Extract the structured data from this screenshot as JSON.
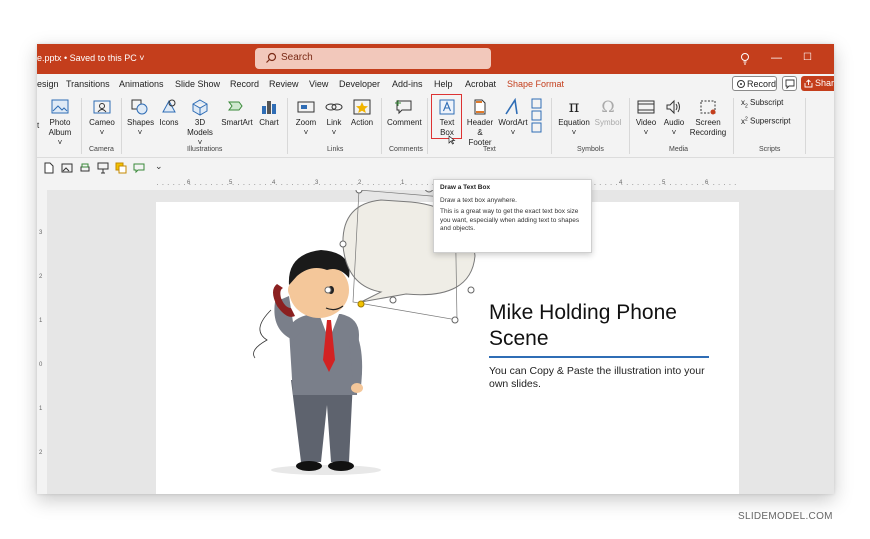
{
  "titlebar": {
    "filename": "e.pptx  •  Saved to this PC ˅",
    "search_placeholder": "Search",
    "help_icon": "lightbulb-icon",
    "minimize_glyph": "—",
    "maximize_glyph": "☐"
  },
  "tabs": [
    "esign",
    "Transitions",
    "Animations",
    "Slide Show",
    "Record",
    "Review",
    "View",
    "Developer",
    "Add-ins",
    "Help",
    "Acrobat"
  ],
  "active_tab": "Shape Format",
  "topright": {
    "record_label": "Record",
    "share_label": "Share"
  },
  "ribbon": {
    "photo_album": {
      "a": "Photo",
      "b": "Album ˅",
      "prefix": "t"
    },
    "cameo": "Cameo",
    "camera_group": "Camera",
    "shapes": "Shapes",
    "icons": "Icons",
    "models": {
      "a": "3D",
      "b": "Models ˅"
    },
    "smartart": "SmartArt",
    "chart": "Chart",
    "illustrations_group": "Illustrations",
    "zoom": "Zoom",
    "link": "Link",
    "action": "Action",
    "links_group": "Links",
    "comment": "Comment",
    "comments_group": "Comments",
    "textbox": {
      "a": "Text",
      "b": "Box"
    },
    "header_footer": {
      "a": "Header",
      "b": "& Footer"
    },
    "wordart": "WordArt",
    "text_group": "Text",
    "equation": "Equation",
    "symbol": "Symbol",
    "symbols_group": "Symbols",
    "video": "Video",
    "audio": "Audio",
    "screen_recording": {
      "a": "Screen",
      "b": "Recording"
    },
    "media_group": "Media",
    "subscript": "Subscript",
    "superscript": "Superscript",
    "scripts_group": "Scripts"
  },
  "ruler": {
    "left_ticks": [
      "6",
      "5",
      "4",
      "3",
      "2",
      "1"
    ],
    "right_ticks": [
      "3",
      "4",
      "5",
      "6"
    ],
    "vertical_ticks": [
      "3",
      "2",
      "1",
      "0",
      "1",
      "2"
    ]
  },
  "tooltip": {
    "title": "Draw a Text Box",
    "line1": "Draw a text box anywhere.",
    "line2": "This is a great way to get the exact text box size you want, especially when adding text to shapes and objects."
  },
  "slide": {
    "title": "Mike Holding Phone Scene",
    "body": "You can Copy & Paste the illustration into your own slides."
  },
  "watermark": "SLIDEMODEL.COM",
  "colors": {
    "accent": "#c43e1c",
    "slide_rule": "#2f6db5",
    "highlight": "#dd3333"
  }
}
